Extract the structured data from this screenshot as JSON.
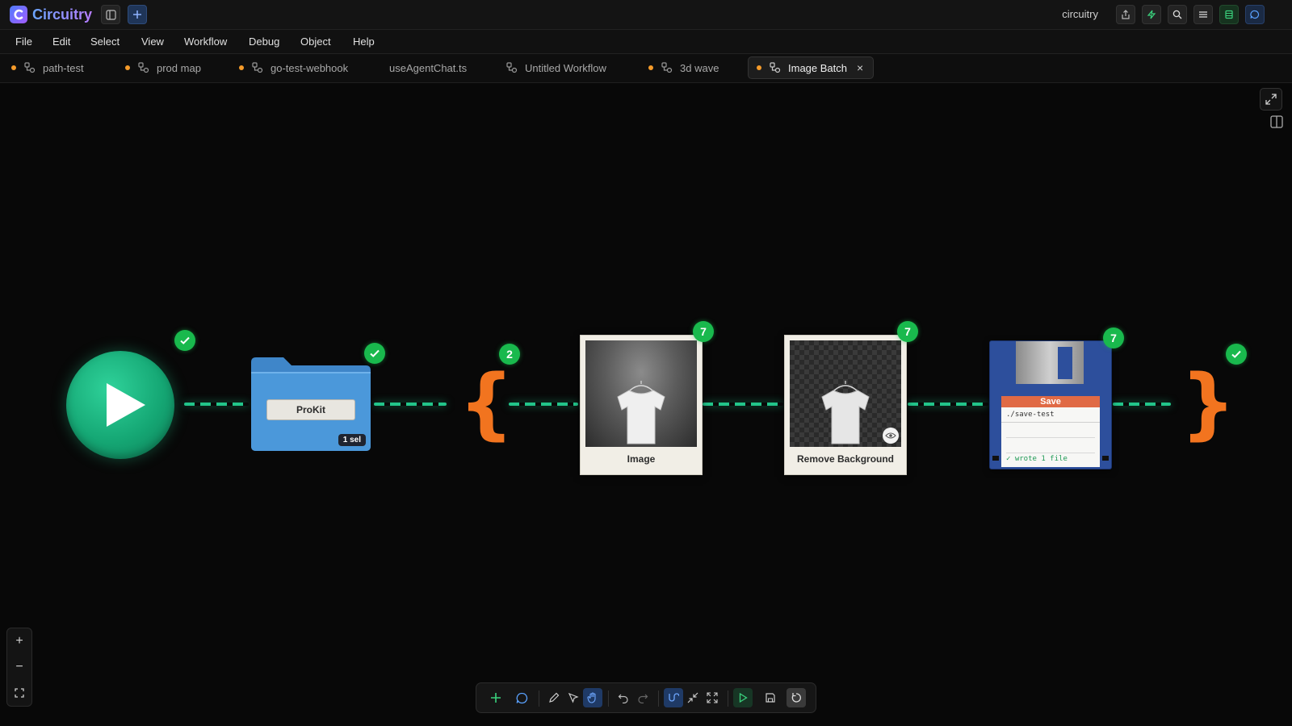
{
  "app": {
    "name": "Circuitry",
    "user": "circuitry"
  },
  "menu": [
    "File",
    "Edit",
    "Select",
    "View",
    "Workflow",
    "Debug",
    "Object",
    "Help"
  ],
  "tabs": [
    {
      "label": "path-test",
      "unsaved": true,
      "icon": "workflow-icon"
    },
    {
      "label": "prod map",
      "unsaved": true,
      "icon": "workflow-icon"
    },
    {
      "label": "go-test-webhook",
      "unsaved": true,
      "icon": "workflow-icon"
    },
    {
      "label": "useAgentChat.ts",
      "unsaved": false,
      "icon": "none"
    },
    {
      "label": "Untitled Workflow",
      "unsaved": false,
      "icon": "workflow-icon"
    },
    {
      "label": "3d wave",
      "unsaved": true,
      "icon": "workflow-icon"
    },
    {
      "label": "Image Batch",
      "unsaved": true,
      "icon": "workflow-icon",
      "active": true,
      "close": "×"
    }
  ],
  "nodes": {
    "start": {
      "status": "done"
    },
    "folder": {
      "label": "ProKit",
      "selection": "1 sel",
      "status": "done"
    },
    "batch": {
      "count": "2",
      "status_after": "done"
    },
    "image": {
      "caption": "Image",
      "count": "7"
    },
    "remove_bg": {
      "caption": "Remove Background",
      "count": "7"
    },
    "save": {
      "title": "Save",
      "path": "./save-test",
      "status": "✓ wrote 1 file",
      "count": "7"
    }
  },
  "zoom_controls": {
    "in": "+",
    "out": "−",
    "fit": "⛶"
  },
  "colors": {
    "wire": "#22c58a",
    "badge": "#19b94d",
    "brace": "#f2741f",
    "unsaved_dot": "#f59b2a",
    "brand_gradient_start": "#6aa6ff",
    "brand_gradient_end": "#b77cff"
  }
}
